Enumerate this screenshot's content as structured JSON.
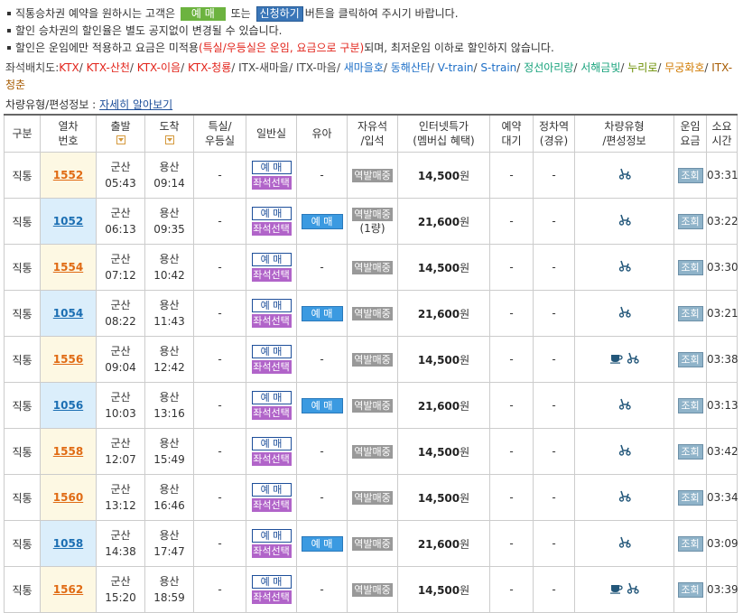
{
  "notice": {
    "line1_a": "직통승차권 예약을 원하시는 고객은",
    "line1_btn1": "예 매",
    "line1_b": "또는",
    "line1_btn2": "신청하기",
    "line1_c": "버튼을 클릭하여 주시기 바랍니다.",
    "line2": "할인 승차권의 할인율은 별도 공지없이 변경될 수 있습니다.",
    "line3_a": "할인은 운임에만 적용하고 요금은 미적용",
    "line3_red": "(특실/우등실은 운임, 요금으로 구분)",
    "line3_b": "되며, 최저운임 이하로 할인하지 않습니다."
  },
  "seat_legend": {
    "label": "좌석배치도:",
    "items": [
      {
        "text": "KTX",
        "color": "#e2231a"
      },
      {
        "text": "KTX-산천",
        "color": "#e2231a"
      },
      {
        "text": "KTX-이음",
        "color": "#e2231a"
      },
      {
        "text": "KTX-청룡",
        "color": "#e2231a"
      },
      {
        "text": "ITX-새마을",
        "color": "#444444"
      },
      {
        "text": "ITX-마음",
        "color": "#444444"
      },
      {
        "text": "새마을호",
        "color": "#1e6fc7"
      },
      {
        "text": "동해산타",
        "color": "#1e6fc7"
      },
      {
        "text": "V-train",
        "color": "#1e6fc7"
      },
      {
        "text": "S-train",
        "color": "#1e6fc7"
      },
      {
        "text": "정선아리랑",
        "color": "#18a37c"
      },
      {
        "text": "서해금빛",
        "color": "#18a37c"
      },
      {
        "text": "누리로",
        "color": "#6a8e00"
      },
      {
        "text": "무궁화호",
        "color": "#d07a00"
      },
      {
        "text": "ITX-청춘",
        "color": "#a65a00"
      }
    ]
  },
  "car_info": {
    "label": "차량유형/편성정보 :",
    "link": "자세히 알아보기"
  },
  "table": {
    "headers": {
      "type": "구분",
      "train_no_1": "열차",
      "train_no_2": "번호",
      "dep": "출발",
      "arr": "도착",
      "special_1": "특실/",
      "special_2": "우등실",
      "general": "일반실",
      "infant": "유아",
      "free_1": "자유석",
      "free_2": "/입석",
      "internet_1": "인터넷특가",
      "internet_2": "(멤버십 혜택)",
      "reserve_1": "예약",
      "reserve_2": "대기",
      "stop_1": "정차역",
      "stop_2": "(경유)",
      "car_1": "차량유형",
      "car_2": "/편성정보",
      "fare_1": "운임",
      "fare_2": "요금",
      "dur_1": "소요",
      "dur_2": "시간"
    },
    "labels": {
      "book": "예 매",
      "seat_select": "좌석선택",
      "station_sale": "역발매중",
      "inquiry": "조회",
      "dash": "-"
    },
    "rows": [
      {
        "type": "직통",
        "no": "1552",
        "dep_st": "군산",
        "dep_t": "05:43",
        "arr_st": "용산",
        "arr_t": "09:14",
        "special": "-",
        "infant": "",
        "infant_dash": "-",
        "free_extra": "",
        "price": "14,500",
        "unit": "원",
        "reserve": "-",
        "stop": "-",
        "cafe": false,
        "dur": "03:31"
      },
      {
        "type": "직통",
        "no": "1052",
        "dep_st": "군산",
        "dep_t": "06:13",
        "arr_st": "용산",
        "arr_t": "09:35",
        "special": "-",
        "infant": "예 매",
        "infant_dash": "",
        "free_extra": "(1량)",
        "price": "21,600",
        "unit": "원",
        "reserve": "-",
        "stop": "-",
        "cafe": false,
        "dur": "03:22"
      },
      {
        "type": "직통",
        "no": "1554",
        "dep_st": "군산",
        "dep_t": "07:12",
        "arr_st": "용산",
        "arr_t": "10:42",
        "special": "-",
        "infant": "",
        "infant_dash": "-",
        "free_extra": "",
        "price": "14,500",
        "unit": "원",
        "reserve": "-",
        "stop": "-",
        "cafe": false,
        "dur": "03:30"
      },
      {
        "type": "직통",
        "no": "1054",
        "dep_st": "군산",
        "dep_t": "08:22",
        "arr_st": "용산",
        "arr_t": "11:43",
        "special": "-",
        "infant": "예 매",
        "infant_dash": "",
        "free_extra": "",
        "price": "21,600",
        "unit": "원",
        "reserve": "-",
        "stop": "-",
        "cafe": false,
        "dur": "03:21"
      },
      {
        "type": "직통",
        "no": "1556",
        "dep_st": "군산",
        "dep_t": "09:04",
        "arr_st": "용산",
        "arr_t": "12:42",
        "special": "-",
        "infant": "",
        "infant_dash": "-",
        "free_extra": "",
        "price": "14,500",
        "unit": "원",
        "reserve": "-",
        "stop": "-",
        "cafe": true,
        "dur": "03:38"
      },
      {
        "type": "직통",
        "no": "1056",
        "dep_st": "군산",
        "dep_t": "10:03",
        "arr_st": "용산",
        "arr_t": "13:16",
        "special": "-",
        "infant": "예 매",
        "infant_dash": "",
        "free_extra": "",
        "price": "21,600",
        "unit": "원",
        "reserve": "-",
        "stop": "-",
        "cafe": false,
        "dur": "03:13"
      },
      {
        "type": "직통",
        "no": "1558",
        "dep_st": "군산",
        "dep_t": "12:07",
        "arr_st": "용산",
        "arr_t": "15:49",
        "special": "-",
        "infant": "",
        "infant_dash": "-",
        "free_extra": "",
        "price": "14,500",
        "unit": "원",
        "reserve": "-",
        "stop": "-",
        "cafe": false,
        "dur": "03:42"
      },
      {
        "type": "직통",
        "no": "1560",
        "dep_st": "군산",
        "dep_t": "13:12",
        "arr_st": "용산",
        "arr_t": "16:46",
        "special": "-",
        "infant": "",
        "infant_dash": "-",
        "free_extra": "",
        "price": "14,500",
        "unit": "원",
        "reserve": "-",
        "stop": "-",
        "cafe": false,
        "dur": "03:34"
      },
      {
        "type": "직통",
        "no": "1058",
        "dep_st": "군산",
        "dep_t": "14:38",
        "arr_st": "용산",
        "arr_t": "17:47",
        "special": "-",
        "infant": "예 매",
        "infant_dash": "",
        "free_extra": "",
        "price": "21,600",
        "unit": "원",
        "reserve": "-",
        "stop": "-",
        "cafe": false,
        "dur": "03:09"
      },
      {
        "type": "직통",
        "no": "1562",
        "dep_st": "군산",
        "dep_t": "15:20",
        "arr_st": "용산",
        "arr_t": "18:59",
        "special": "-",
        "infant": "",
        "infant_dash": "-",
        "free_extra": "",
        "price": "14,500",
        "unit": "원",
        "reserve": "-",
        "stop": "-",
        "cafe": true,
        "dur": "03:39"
      }
    ]
  }
}
